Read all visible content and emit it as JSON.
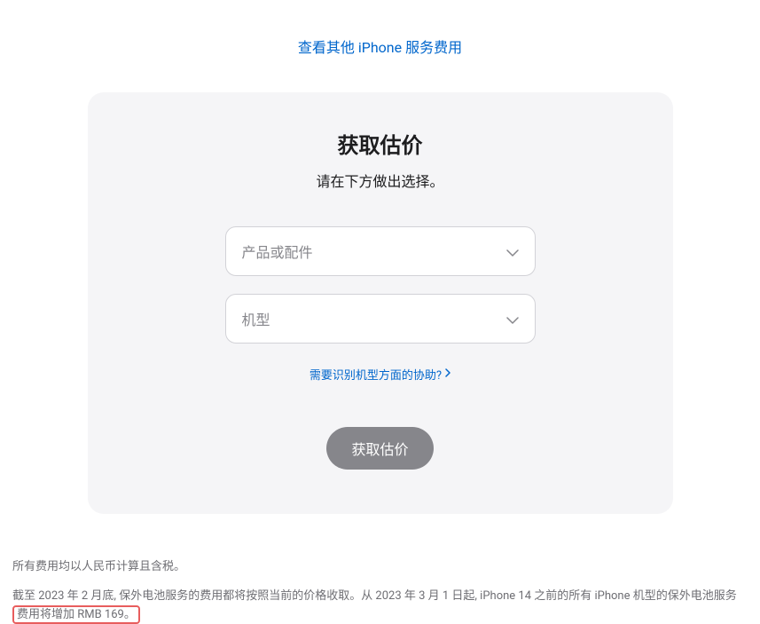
{
  "topLink": "查看其他 iPhone 服务费用",
  "card": {
    "title": "获取估价",
    "subtitle": "请在下方做出选择。",
    "select1": "产品或配件",
    "select2": "机型",
    "helpLink": "需要识别机型方面的协助?",
    "submitLabel": "获取估价"
  },
  "footer": {
    "line1": "所有费用均以人民币计算且含税。",
    "line2_part1": "截至 2023 年 2 月底, 保外电池服务的费用都将按照当前的价格收取。从 2023 年 3 月 1 日起, iPhone 14 之前的所有 iPhone 机型的保外电池服务",
    "line2_part2": "费用将增加 RMB 169。"
  }
}
